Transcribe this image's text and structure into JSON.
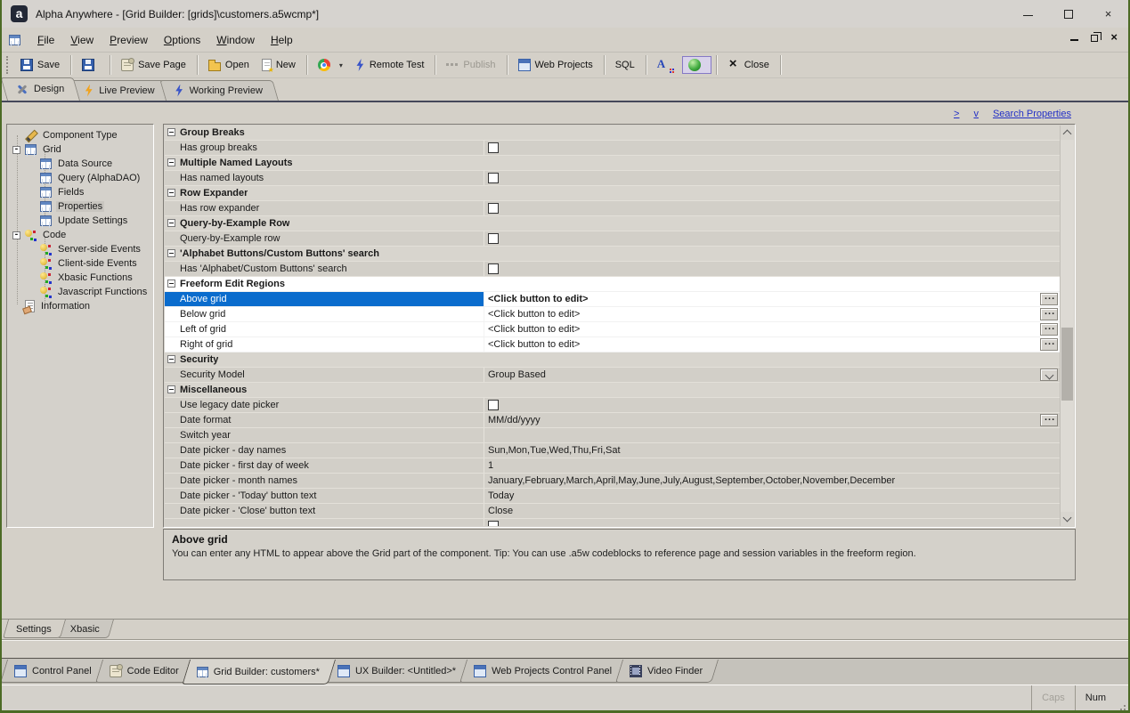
{
  "window": {
    "title": "Alpha Anywhere - [Grid Builder: [grids]\\customers.a5wcmp*]",
    "logo_letter": "a"
  },
  "menu": {
    "items": [
      "File",
      "View",
      "Preview",
      "Options",
      "Window",
      "Help"
    ]
  },
  "toolbar": {
    "items": [
      {
        "cls": "tb-btn",
        "icon": "ic-save",
        "label": "Save"
      },
      {
        "cls": "tb-sep"
      },
      {
        "cls": "tb-btn",
        "icon": "ic-save",
        "label": ""
      },
      {
        "cls": "tb-sep"
      },
      {
        "cls": "tb-btn",
        "icon": "ic-scroll",
        "label": "Save Page"
      },
      {
        "cls": "tb-sep"
      },
      {
        "cls": "tb-btn",
        "icon": "ic-folder",
        "label": "Open"
      },
      {
        "cls": "tb-btn",
        "icon": "ic-newpage",
        "label": "New"
      },
      {
        "cls": "tb-sep"
      },
      {
        "cls": "tb-btn",
        "icon": "ic-chrome",
        "label": "",
        "caret": "▾"
      },
      {
        "cls": "tb-btn",
        "icon": "ic-bolt-blue",
        "label": "Remote Test"
      },
      {
        "cls": "tb-sep"
      },
      {
        "cls": "tb-btn disabled",
        "icon": "ic-dots",
        "label": "Publish"
      },
      {
        "cls": "tb-sep"
      },
      {
        "cls": "tb-btn",
        "icon": "ic-window",
        "label": "Web Projects"
      },
      {
        "cls": "tb-sep"
      },
      {
        "cls": "tb-btn",
        "icon": "ic-none",
        "label": "SQL"
      },
      {
        "cls": "tb-sep"
      },
      {
        "cls": "tb-btn",
        "icon": "ic-fontA",
        "label": ""
      },
      {
        "cls": "tb-btn pressed",
        "icon": "ic-sphere",
        "label": ""
      },
      {
        "cls": "tb-sep"
      },
      {
        "cls": "tb-btn",
        "icon": "ic-x",
        "label": "Close"
      },
      {
        "cls": "tb-sep"
      }
    ]
  },
  "view_tabs": [
    {
      "label": "Design",
      "icon": "ic-tools",
      "cls": "active"
    },
    {
      "label": "Live Preview",
      "icon": "ic-bolt-orange",
      "cls": ""
    },
    {
      "label": "Working Preview",
      "icon": "ic-bolt-blue",
      "cls": ""
    }
  ],
  "header_links": {
    "collapse": ">",
    "expand": "v",
    "search": "Search Properties"
  },
  "tree": {
    "items": [
      {
        "label": "Component Type",
        "icon": "ic-pencil",
        "cls": "lvl0",
        "exp": ""
      },
      {
        "label": "Grid",
        "icon": "ic-table",
        "cls": "lvl0",
        "exp": "-"
      },
      {
        "label": "Data Source",
        "icon": "ic-table",
        "cls": "lvl1"
      },
      {
        "label": "Query (AlphaDAO)",
        "icon": "ic-table",
        "cls": "lvl1"
      },
      {
        "label": "Fields",
        "icon": "ic-table",
        "cls": "lvl1"
      },
      {
        "label": "Properties",
        "icon": "ic-table",
        "cls": "lvl1 sel"
      },
      {
        "label": "Update Settings",
        "icon": "ic-table",
        "cls": "lvl1"
      },
      {
        "label": "Code",
        "icon": "ic-code",
        "cls": "lvl0",
        "exp": "-"
      },
      {
        "label": "Server-side Events",
        "icon": "ic-code",
        "cls": "lvl1"
      },
      {
        "label": "Client-side Events",
        "icon": "ic-code",
        "cls": "lvl1"
      },
      {
        "label": "Xbasic Functions",
        "icon": "ic-code",
        "cls": "lvl1"
      },
      {
        "label": "Javascript Functions",
        "icon": "ic-code",
        "cls": "lvl1"
      },
      {
        "label": "Information",
        "icon": "ic-info",
        "cls": "lvl0",
        "exp": ""
      }
    ]
  },
  "properties": {
    "rows": [
      {
        "cls": "section",
        "label": "Group Breaks",
        "value": "",
        "ctrl": "ctl-none"
      },
      {
        "cls": "prop",
        "label": "Has group breaks",
        "value": "",
        "ctrl": "ctl-check"
      },
      {
        "cls": "section",
        "label": "Multiple Named Layouts",
        "value": "",
        "ctrl": "ctl-none"
      },
      {
        "cls": "prop",
        "label": "Has named layouts",
        "value": "",
        "ctrl": "ctl-check"
      },
      {
        "cls": "section",
        "label": "Row Expander",
        "value": "",
        "ctrl": "ctl-none"
      },
      {
        "cls": "prop",
        "label": "Has row expander",
        "value": "",
        "ctrl": "ctl-check"
      },
      {
        "cls": "section",
        "label": "Query-by-Example Row",
        "value": "",
        "ctrl": "ctl-none"
      },
      {
        "cls": "prop",
        "label": "Query-by-Example row",
        "value": "",
        "ctrl": "ctl-check"
      },
      {
        "cls": "section",
        "label": "'Alphabet Buttons/Custom Buttons' search",
        "value": "",
        "ctrl": "ctl-none"
      },
      {
        "cls": "prop",
        "label": "Has 'Alphabet/Custom Buttons' search",
        "value": "",
        "ctrl": "ctl-check"
      },
      {
        "cls": "section hl",
        "label": "Freeform Edit Regions",
        "value": "",
        "ctrl": "ctl-none"
      },
      {
        "cls": "prop hl sel vb",
        "label": "Above grid",
        "value": "<Click button to edit>",
        "ctrl": "ctl-ellipsis"
      },
      {
        "cls": "prop hl",
        "label": "Below grid",
        "value": "<Click button to edit>",
        "ctrl": "ctl-ellipsis"
      },
      {
        "cls": "prop hl",
        "label": "Left of grid",
        "value": "<Click button to edit>",
        "ctrl": "ctl-ellipsis"
      },
      {
        "cls": "prop hl",
        "label": "Right of grid",
        "value": "<Click button to edit>",
        "ctrl": "ctl-ellipsis"
      },
      {
        "cls": "section",
        "label": "Security",
        "value": "",
        "ctrl": "ctl-none"
      },
      {
        "cls": "prop",
        "label": "Security Model",
        "value": "Group Based",
        "ctrl": "ctl-drop"
      },
      {
        "cls": "section",
        "label": "Miscellaneous",
        "value": "",
        "ctrl": "ctl-none"
      },
      {
        "cls": "prop",
        "label": "Use legacy date picker",
        "value": "",
        "ctrl": "ctl-check"
      },
      {
        "cls": "prop",
        "label": "Date format",
        "value": "MM/dd/yyyy",
        "ctrl": "ctl-ellipsis"
      },
      {
        "cls": "prop",
        "label": "Switch year",
        "value": "",
        "ctrl": "ctl-none"
      },
      {
        "cls": "prop",
        "label": "Date picker - day names",
        "value": "Sun,Mon,Tue,Wed,Thu,Fri,Sat",
        "ctrl": "ctl-none"
      },
      {
        "cls": "prop",
        "label": "Date picker - first day of week",
        "value": "1",
        "ctrl": "ctl-none"
      },
      {
        "cls": "prop",
        "label": "Date picker - month names",
        "value": "January,February,March,April,May,June,July,August,September,October,November,December",
        "ctrl": "ctl-none"
      },
      {
        "cls": "prop",
        "label": "Date picker - 'Today' button text",
        "value": "Today",
        "ctrl": "ctl-none"
      },
      {
        "cls": "prop",
        "label": "Date picker - 'Close' button text",
        "value": "Close",
        "ctrl": "ctl-none"
      },
      {
        "cls": "prop",
        "label": "",
        "value": "",
        "ctrl": "ctl-check"
      }
    ]
  },
  "description": {
    "title": "Above grid",
    "text": "You can enter any HTML to appear above the Grid part of the component. Tip: You can use .a5w codeblocks to reference page and session variables in the freeform region."
  },
  "panel_tabs": [
    {
      "label": "Settings",
      "cls": "active"
    },
    {
      "label": "Xbasic",
      "cls": ""
    }
  ],
  "mdi_tabs": [
    {
      "label": "Control Panel",
      "icon": "ic-window",
      "cls": ""
    },
    {
      "label": "Code Editor",
      "icon": "ic-scroll",
      "cls": ""
    },
    {
      "label": "Grid Builder: customers*",
      "icon": "ic-table",
      "cls": "active"
    },
    {
      "label": "UX Builder: <Untitled>*",
      "icon": "ic-window",
      "cls": ""
    },
    {
      "label": "Web Projects Control Panel",
      "icon": "ic-window",
      "cls": ""
    },
    {
      "label": "Video Finder",
      "icon": "ic-film",
      "cls": ""
    }
  ],
  "status": {
    "caps": "Caps",
    "num": "Num"
  },
  "colors": {
    "selection": "#0a6ccd",
    "chrome": "#d4d0c8",
    "window_border": "#4c6b25",
    "link": "#2330c6"
  }
}
